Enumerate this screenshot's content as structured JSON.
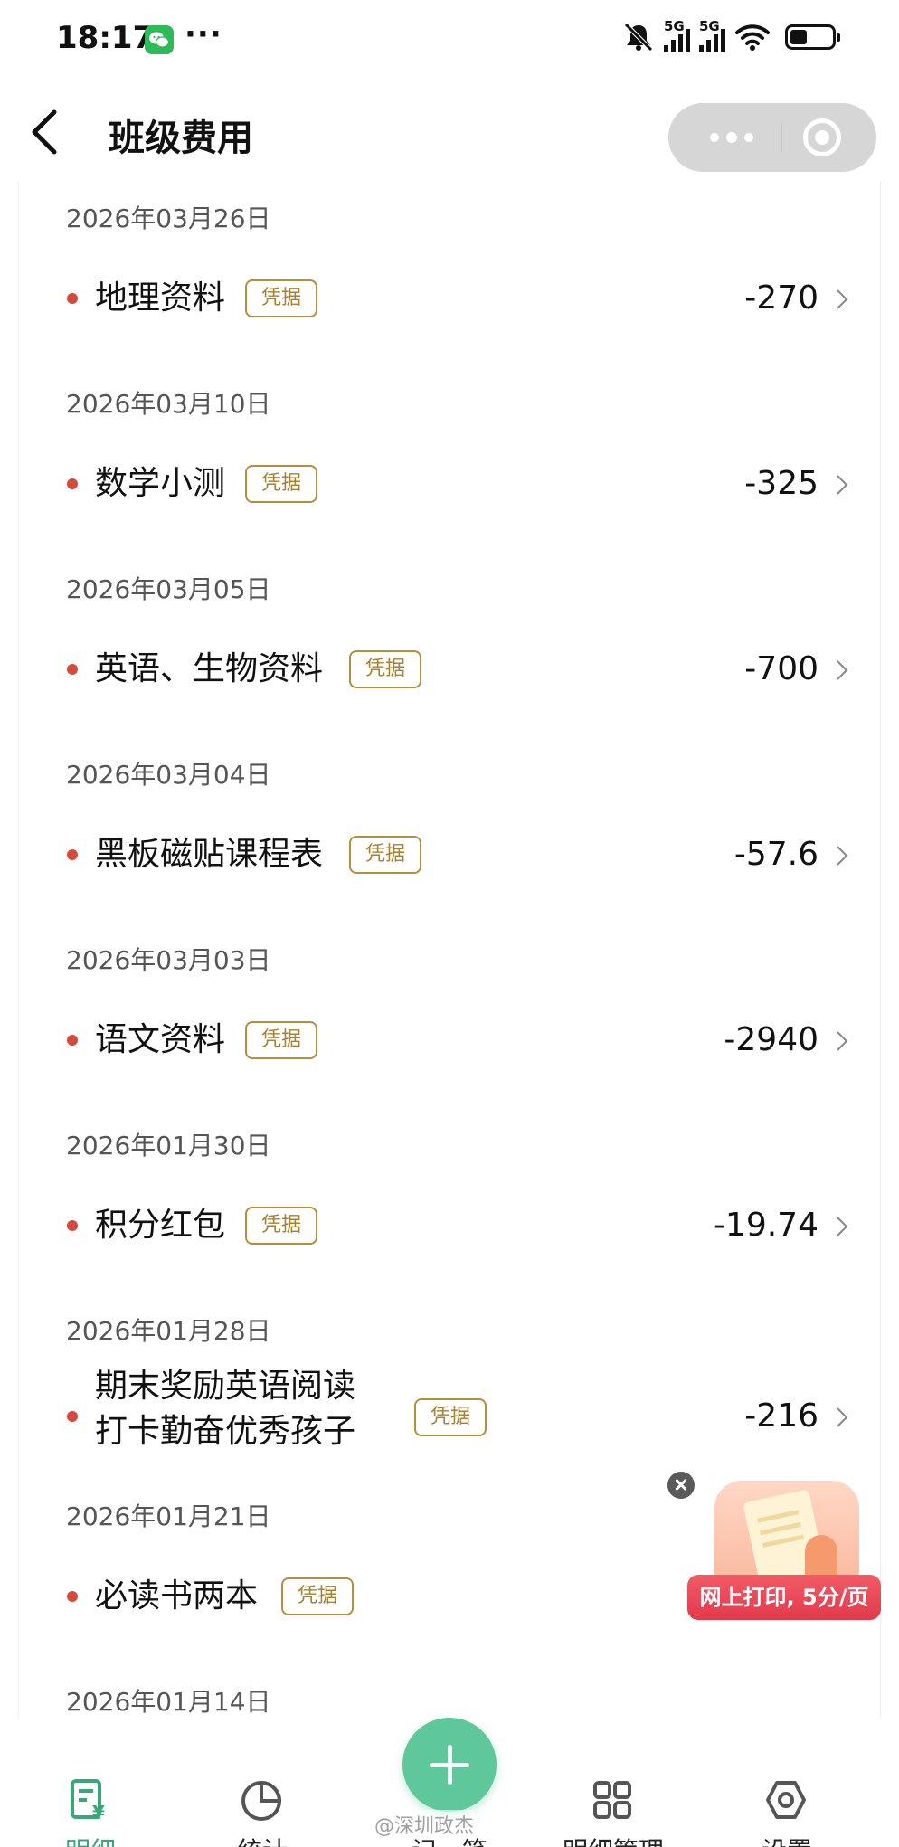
{
  "status_bar": {
    "time": "18:17",
    "dots": "···",
    "network_1": "5G",
    "network_2": "5G",
    "icons": [
      "wechat-icon",
      "silent-icon",
      "signal-icon",
      "wifi-icon",
      "battery-icon"
    ]
  },
  "header": {
    "title": "班级费用",
    "icons": [
      "back-icon",
      "more-icon",
      "close-target-icon"
    ]
  },
  "entries": [
    {
      "date": "2026年03月26日",
      "name": "地理资料",
      "badge": "凭据",
      "amount": "-270"
    },
    {
      "date": "2026年03月10日",
      "name": "数学小测",
      "badge": "凭据",
      "amount": "-325"
    },
    {
      "date": "2026年03月05日",
      "name": "英语、生物资料",
      "badge": "凭据",
      "amount": "-700"
    },
    {
      "date": "2026年03月04日",
      "name": "黑板磁贴课程表",
      "badge": "凭据",
      "amount": "-57.6"
    },
    {
      "date": "2026年03月03日",
      "name": "语文资料",
      "badge": "凭据",
      "amount": "-2940"
    },
    {
      "date": "2026年01月30日",
      "name": "积分红包",
      "badge": "凭据",
      "amount": "-19.74"
    },
    {
      "date": "2026年01月28日",
      "name_line1": "期末奖励英语阅读",
      "name_line2": "打卡勤奋优秀孩子",
      "badge": "凭据",
      "amount": "-216"
    },
    {
      "date": "2026年01月21日",
      "name": "必读书两本",
      "badge": "凭据",
      "amount": ""
    },
    {
      "date": "2026年01月14日"
    }
  ],
  "ad": {
    "label": "网上打印, 5分/页"
  },
  "tabs": [
    {
      "label": "明细",
      "icon": "ledger-icon",
      "active": true
    },
    {
      "label": "统计",
      "icon": "pie-chart-icon",
      "active": false
    },
    {
      "label": "记一笔",
      "icon": "plus-icon",
      "active": false
    },
    {
      "label": "明细管理",
      "icon": "grid-icon",
      "active": false
    },
    {
      "label": "设置",
      "icon": "settings-icon",
      "active": false
    }
  ],
  "watermark": "@深圳政杰",
  "colors": {
    "accent_green": "#5fc89b",
    "dot_red": "#d44a3c",
    "badge_gold": "#b88d3c",
    "ad_red": "#e23a4c"
  }
}
